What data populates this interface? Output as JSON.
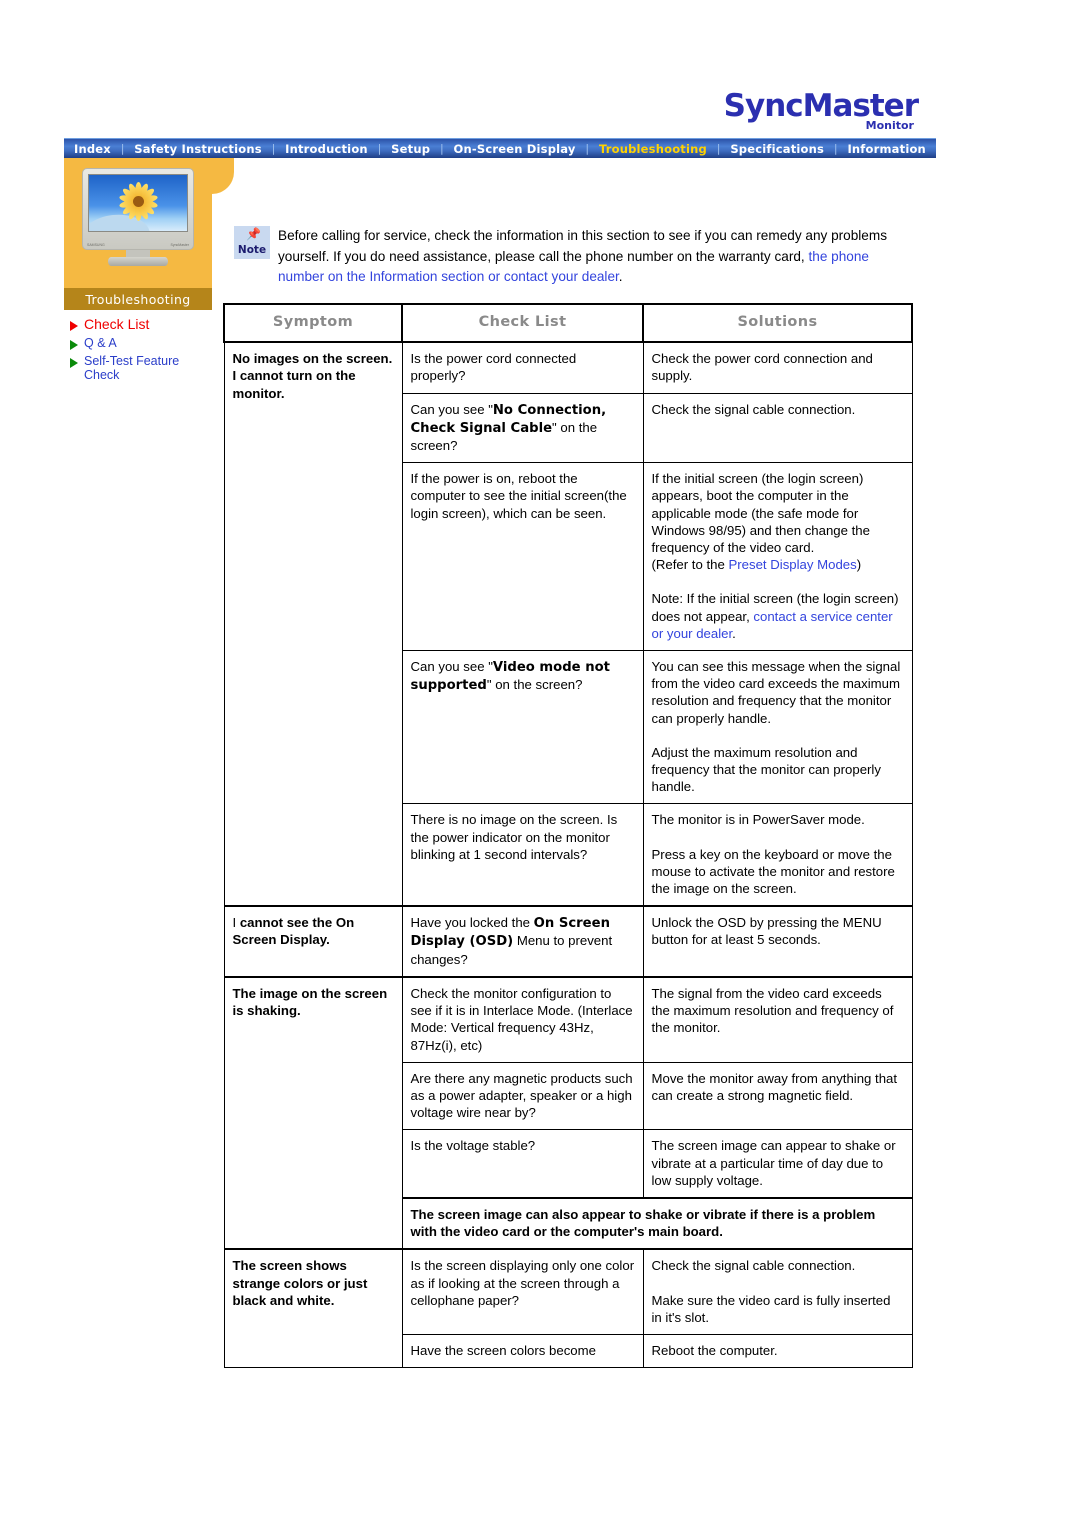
{
  "brand": {
    "name": "SyncMaster",
    "sub": "Monitor"
  },
  "nav": {
    "items": [
      {
        "label": "Index",
        "active": false
      },
      {
        "label": "Safety Instructions",
        "active": false
      },
      {
        "label": "Introduction",
        "active": false
      },
      {
        "label": "Setup",
        "active": false
      },
      {
        "label": "On-Screen Display",
        "active": false
      },
      {
        "label": "Troubleshooting",
        "active": true
      },
      {
        "label": "Specifications",
        "active": false
      },
      {
        "label": "Information",
        "active": false
      }
    ],
    "separator": "|",
    "active_color": "#ffd200",
    "bar_color": "#3e6cc0"
  },
  "sidebar": {
    "thumbnail_caption": "Troubleshooting",
    "thumbnail_panel_color": "#f5b942",
    "caption_bar_color": "#b5851a",
    "items": [
      {
        "label": "Check List",
        "current": true,
        "bullet": "red-triangle-icon"
      },
      {
        "label": "Q & A",
        "current": false,
        "bullet": "green-triangle-icon"
      },
      {
        "label": "Self-Test Feature Check",
        "current": false,
        "bullet": "green-triangle-icon"
      }
    ]
  },
  "note": {
    "badge_label": "Note",
    "badge_icon": "pushpin-icon",
    "text_plain": "Before calling for service, check the information in this section to see if you can remedy any problems yourself. If you do need assistance, please call the phone number on the warranty card,",
    "text_link": " the phone number on the Information section or contact your dealer",
    "text_tail": "."
  },
  "table": {
    "headers": [
      "Symptom",
      "Check List",
      "Solutions"
    ],
    "groups": [
      {
        "symptom": "No images on the screen. I cannot turn on the monitor.",
        "rows": [
          {
            "check": "Is the power cord connected properly?",
            "solution": "Check the power cord connection and supply."
          },
          {
            "check_pre": "Can you see \"",
            "check_bold": "No Connection, Check Signal Cable",
            "check_post": "\" on the screen?",
            "solution": "Check the signal cable connection."
          },
          {
            "check": "If the power is on, reboot the computer to see the initial screen(the login screen), which can be seen.",
            "solution_p1": "If the initial screen (the login screen) appears, boot the computer in the applicable mode (the safe mode for Windows 98/95) and then change the frequency of the video card.",
            "solution_p1b": "(Refer to the ",
            "solution_p1_link": "Preset Display Modes",
            "solution_p1c": ")",
            "solution_p2": "Note: If the initial screen (the login screen) does not appear, ",
            "solution_p2_link": "contact a service center or your dealer",
            "solution_p2_tail": "."
          },
          {
            "check_pre": "Can you see \"",
            "check_bold": "Video mode not supported",
            "check_post": "\" on the screen?",
            "solution_p1": "You can see this message when the signal from the video card exceeds the maximum resolution and frequency that the monitor can properly handle.",
            "solution_p2": "Adjust the maximum resolution and frequency that the monitor can properly handle."
          },
          {
            "check": "There is no image on the screen. Is the power indicator on the monitor blinking at 1 second intervals?",
            "solution_p1": "The monitor is in PowerSaver mode.",
            "solution_p2": "Press a key on the keyboard or move the mouse to activate the monitor and restore the image on the screen."
          }
        ]
      },
      {
        "symptom_pre": "I ",
        "symptom_bold": "cannot see the On Screen Display.",
        "rows": [
          {
            "check_pre": "Have you locked the ",
            "check_bold": "On Screen Display (OSD)",
            "check_post": " Menu to prevent changes?",
            "solution": "Unlock the OSD by pressing the MENU button for at least 5 seconds."
          }
        ]
      },
      {
        "symptom": "The image on the screen is shaking.",
        "rows": [
          {
            "check": "Check the monitor configuration to see if it is in Interlace Mode. (Interlace Mode: Vertical frequency 43Hz, 87Hz(i), etc)",
            "solution": "The signal from the video card exceeds the maximum resolution and frequency of the monitor."
          },
          {
            "check": "Are there any magnetic products such as a power adapter, speaker or a high voltage wire near by?",
            "solution": "Move the monitor away from anything that can create a strong magnetic field."
          },
          {
            "check": "Is the voltage stable?",
            "solution": "The screen image can appear to shake or vibrate at a particular time of day due to low supply voltage."
          },
          {
            "span_note": "The screen image can also appear to shake or vibrate if there is a problem with the video card or the computer's main board."
          }
        ]
      },
      {
        "symptom": "The screen shows strange colors or just black and white.",
        "rows": [
          {
            "check": "Is the screen displaying only one color as if looking at the screen through a cellophane paper?",
            "solution_p1": "Check the signal cable connection.",
            "solution_p2": "Make sure the video card is fully inserted in it's slot."
          },
          {
            "check": "Have the screen colors become",
            "solution": "Reboot the computer."
          }
        ]
      }
    ]
  }
}
